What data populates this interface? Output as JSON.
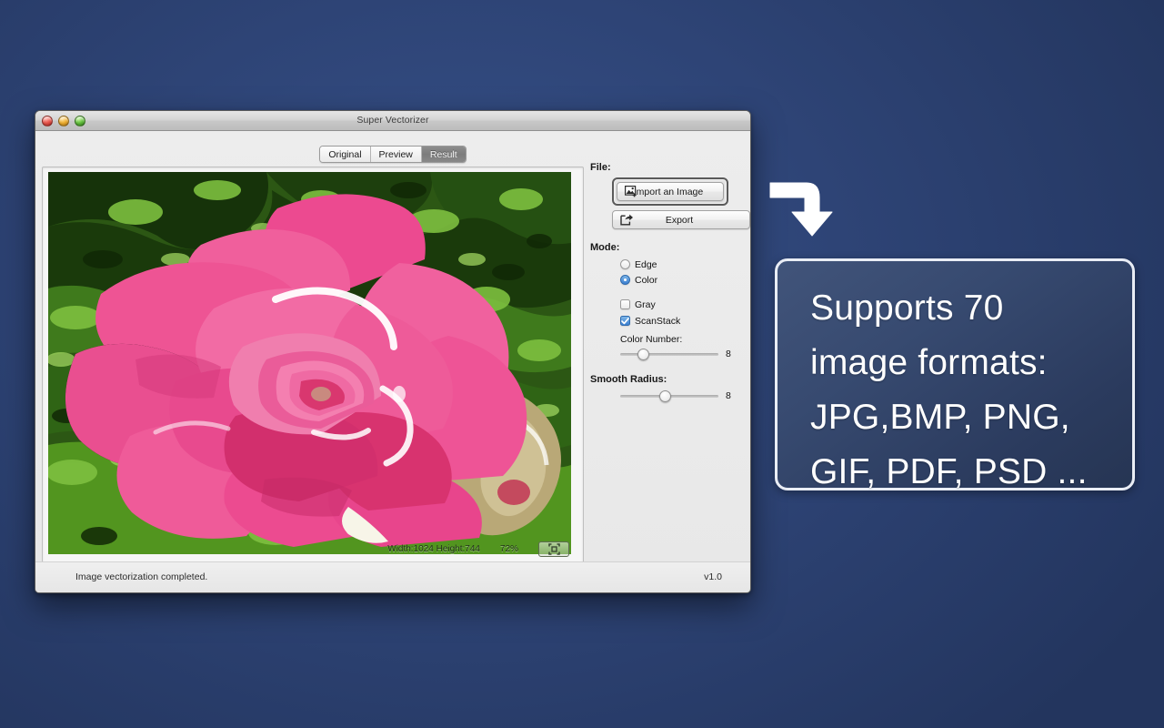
{
  "window": {
    "title": "Super Vectorizer",
    "traffic_lights": [
      "close-button",
      "minimize-button",
      "zoom-button"
    ]
  },
  "tabs": [
    {
      "label": "Original",
      "selected": false
    },
    {
      "label": "Preview",
      "selected": false
    },
    {
      "label": "Result",
      "selected": true
    }
  ],
  "canvas": {
    "width_label": "Width:1024 Height:744",
    "zoom_label": "72%",
    "fit_icon": "fit-to-screen-icon"
  },
  "panel": {
    "file": {
      "label": "File:",
      "import_label": "Import an Image",
      "import_icon": "image-add-icon",
      "export_label": "Export",
      "export_icon": "export-arrow-icon"
    },
    "mode": {
      "label": "Mode:",
      "options": [
        {
          "label": "Edge",
          "type": "radio",
          "checked": false
        },
        {
          "label": "Color",
          "type": "radio",
          "checked": true
        },
        {
          "label": "Gray",
          "type": "checkbox",
          "checked": false
        },
        {
          "label": "ScanStack",
          "type": "checkbox",
          "checked": true
        }
      ]
    },
    "color_number": {
      "label": "Color Number:",
      "value": "8",
      "knob_percent": 24
    },
    "smooth_radius": {
      "label": "Smooth Radius:",
      "value": "8",
      "knob_percent": 46
    },
    "thumbnail": "original-image-thumbnail"
  },
  "statusbar": {
    "message": "Image vectorization completed.",
    "version": "v1.0"
  },
  "annotation": {
    "arrow": "curved-down-arrow",
    "callout_text": "Supports 70\nimage formats:\nJPG,BMP, PNG,\nGIF, PDF, PSD ..."
  },
  "colors": {
    "desktop_background": "#2b4272",
    "callout_background": "#374a70",
    "callout_border": "#e9edf5",
    "accent_blue": "#3b7fd0",
    "selected_tab": "#828282",
    "rose_pink": "#ef4f93",
    "rose_pink_dark": "#d62f74",
    "foliage_green": "#4e8a22",
    "foliage_dark": "#17340a"
  }
}
